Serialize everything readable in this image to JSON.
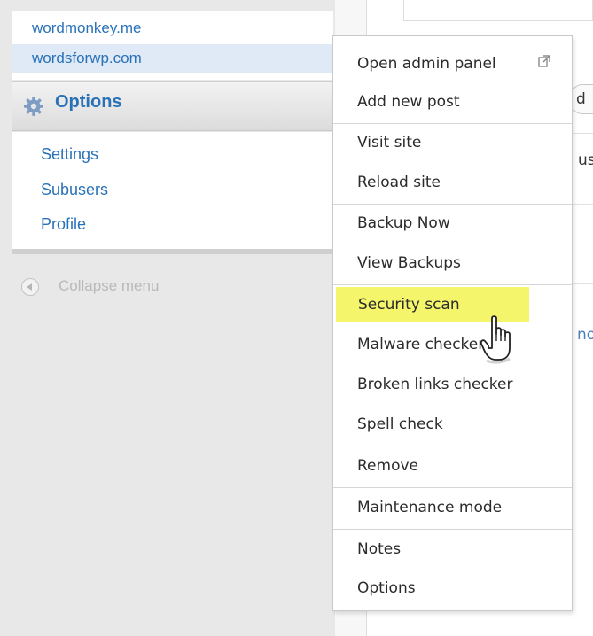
{
  "sites": [
    {
      "label": "wordmonkey.me"
    },
    {
      "label": "wordsforwp.com"
    }
  ],
  "options": {
    "title": "Options",
    "links": [
      "Settings",
      "Subusers",
      "Profile"
    ]
  },
  "collapse": {
    "label": "Collapse menu"
  },
  "background": {
    "peek_1": "d",
    "peek_2": "us",
    "peek_3": "no"
  },
  "context_menu": {
    "items": [
      {
        "label": "Open admin panel",
        "icon": "external-link-icon"
      },
      {
        "label": "Add new post"
      },
      {
        "label": "Visit site"
      },
      {
        "label": "Reload site"
      },
      {
        "label": "Backup Now"
      },
      {
        "label": "View Backups"
      },
      {
        "label": "Security scan",
        "highlighted": true
      },
      {
        "label": "Malware checker"
      },
      {
        "label": "Broken links checker"
      },
      {
        "label": "Spell check"
      },
      {
        "label": "Remove"
      },
      {
        "label": "Maintenance mode"
      },
      {
        "label": "Notes"
      },
      {
        "label": "Options"
      }
    ],
    "highlight_color": "#f4f56a"
  },
  "colors": {
    "link": "#2a72b8",
    "muted": "#b9b9b9"
  }
}
